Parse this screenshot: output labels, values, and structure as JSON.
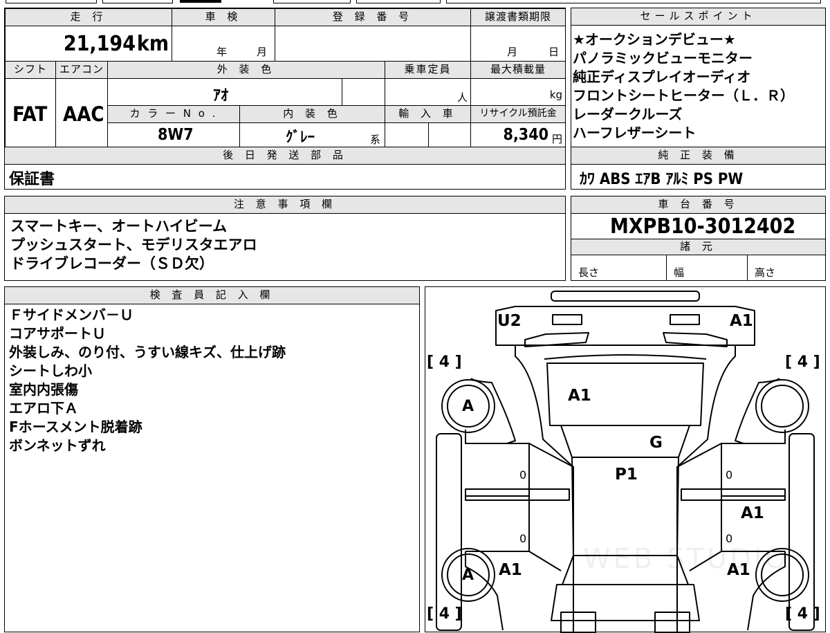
{
  "top": {
    "mileage_label": "走 行",
    "mileage_value": "21,194",
    "mileage_unit": "km",
    "inspection_label": "車 検",
    "year_unit": "年",
    "month_unit": "月",
    "registration_label": "登 録 番 号",
    "transfer_label": "譲渡書類期限",
    "transfer_month": "月",
    "transfer_day": "日"
  },
  "mid": {
    "shift_label": "シフト",
    "ac_label": "エアコン",
    "ext_color_label": "外 装 色",
    "capacity_label": "乗車定員",
    "max_load_label": "最大積載量",
    "shift_value": "FAT",
    "ac_value": "AAC",
    "ext_color_value": "ｱｵ",
    "capacity_unit": "人",
    "load_unit": "kg",
    "color_no_label": "カ ラ ー N o .",
    "int_color_label": "内 装 色",
    "import_label": "輸 入 車",
    "recycle_label": "リサイクル預託金",
    "color_no_value": "8W7",
    "int_color_value": "ｸﾞﾚｰ",
    "int_color_suffix": "系",
    "recycle_value": "8,340",
    "recycle_unit": "円"
  },
  "later_parts": {
    "label": "後 日 発 送 部 品",
    "value": "保証書"
  },
  "sales_points": {
    "label": "セールスポイント",
    "items": [
      "★オークションデビュー★",
      "パノラミックビューモニター",
      "純正ディスプレイオーディオ",
      "フロントシートヒーター（Ｌ．Ｒ）",
      "レーダークルーズ",
      "ハーフレザーシート"
    ]
  },
  "equipment": {
    "label": "純 正 装 備",
    "value": "ｶﾜ ABS ｴｱB ｱﾙﾐ PS PW"
  },
  "notes": {
    "label": "注 意 事 項 欄",
    "lines": [
      "スマートキー、オートハイビーム",
      "プッシュスタート、モデリスタエアロ",
      "ドライブレコーダー（ＳＤ欠）"
    ]
  },
  "chassis": {
    "label": "車 台 番 号",
    "value": "MXPB10-3012402",
    "spec_label": "諸 元",
    "length_label": "長さ",
    "width_label": "幅",
    "height_label": "高さ"
  },
  "inspector": {
    "label": "検 査 員 記 入 欄",
    "lines": [
      "Ｆサイドメンバ－Ｕ",
      "コアサポートＵ",
      "外装しみ、のり付、うすい線キズ、仕上げ跡",
      "シートしわ小",
      "室内内張傷",
      "エアロ下Ａ",
      "Fホースメント脱着跡",
      "ボンネットずれ"
    ]
  },
  "diagram": {
    "marks": {
      "u2": "U2",
      "a1_top_right": "A1",
      "a1_hood": "A1",
      "g": "G",
      "p1": "P1",
      "a1_right_door": "A1",
      "a1_left_rear": "A1",
      "a1_right_rear": "A1",
      "a_front_left": "A",
      "a_rear_left": "A",
      "zero_1": "0",
      "zero_2": "0",
      "zero_3": "0",
      "zero_4": "0"
    },
    "tire_labels": {
      "fl": "[ 4 ]",
      "fr": "[ 4 ]",
      "rl": "[ 4 ]",
      "rr": "[ 4 ]"
    },
    "watermark": "WEB STUDIO"
  }
}
